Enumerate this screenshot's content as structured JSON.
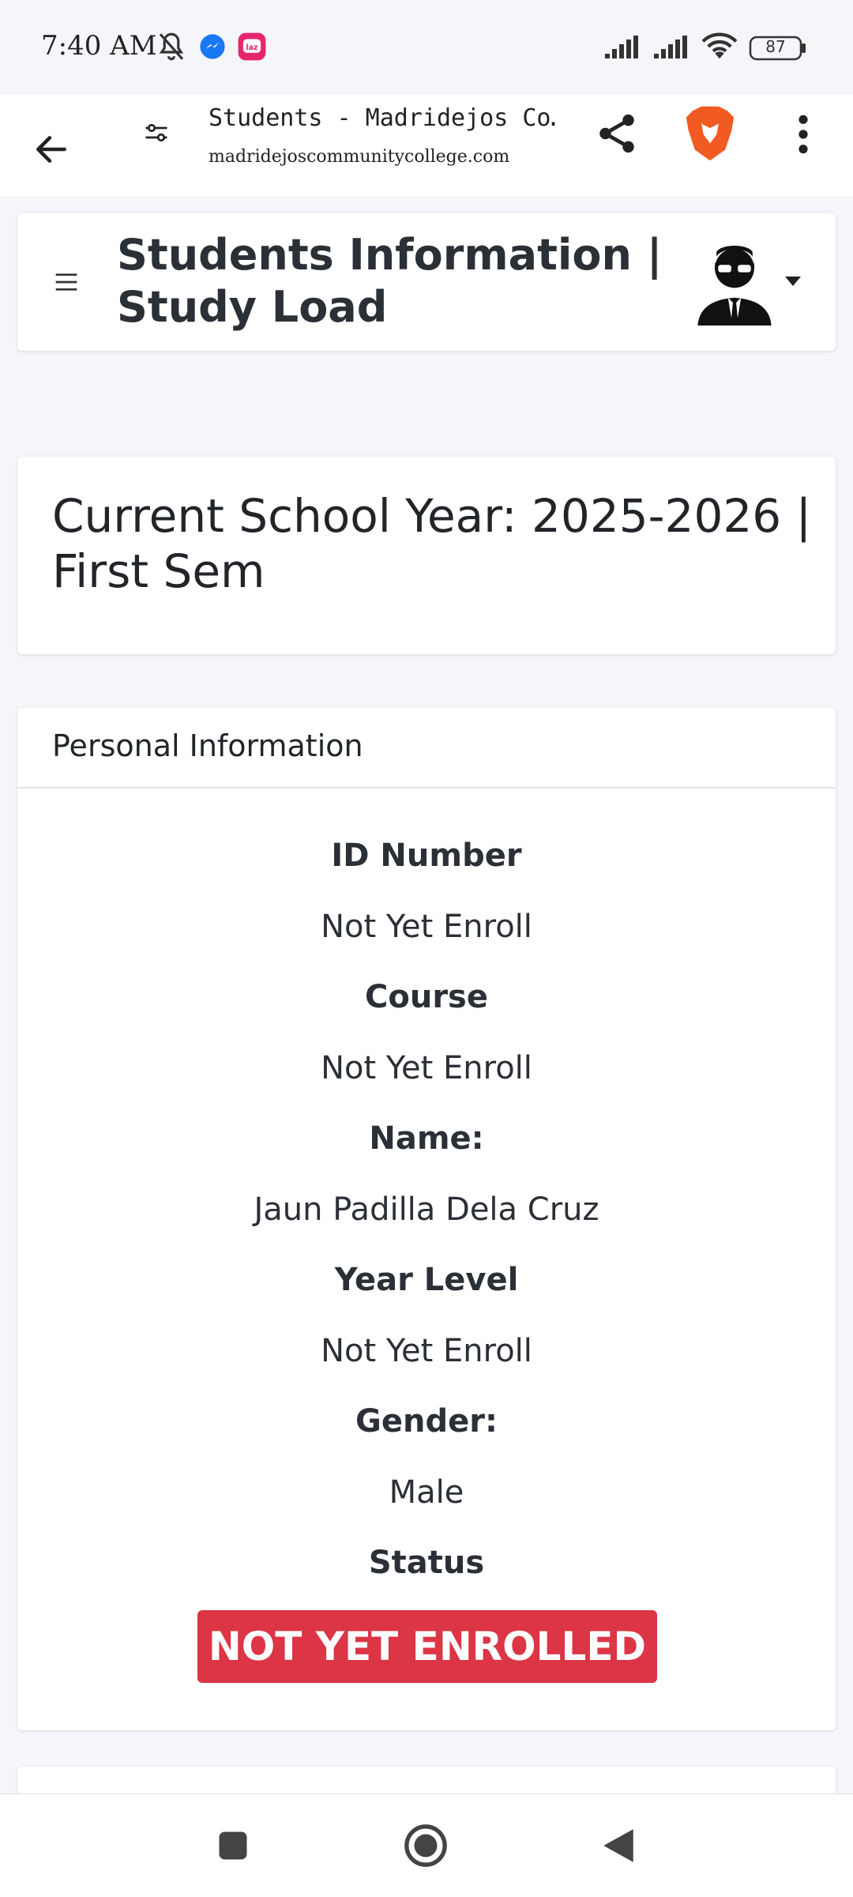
{
  "status_bar": {
    "time": "7:40 AM",
    "battery": "87"
  },
  "browser": {
    "tab_title": "Students - Madridejos Co…",
    "url": "madridejoscommunitycollege.com"
  },
  "header": {
    "title": "Students Information | Study Load"
  },
  "school_year": {
    "text": "Current School Year: 2025-2026 | First Sem"
  },
  "personal_info": {
    "heading": "Personal Information",
    "fields": [
      {
        "label": "ID Number",
        "value": "Not Yet Enroll"
      },
      {
        "label": "Course",
        "value": "Not Yet Enroll"
      },
      {
        "label": "Name:",
        "value": "Jaun Padilla Dela Cruz"
      },
      {
        "label": "Year Level",
        "value": "Not Yet Enroll"
      },
      {
        "label": "Gender:",
        "value": "Male"
      }
    ],
    "status_label": "Status",
    "status_badge": "NOT YET ENROLLED"
  },
  "colors": {
    "badge": "#dc3545",
    "brave": "#f15a22",
    "messenger": "#1877f2",
    "lazada": "#e5266f"
  }
}
